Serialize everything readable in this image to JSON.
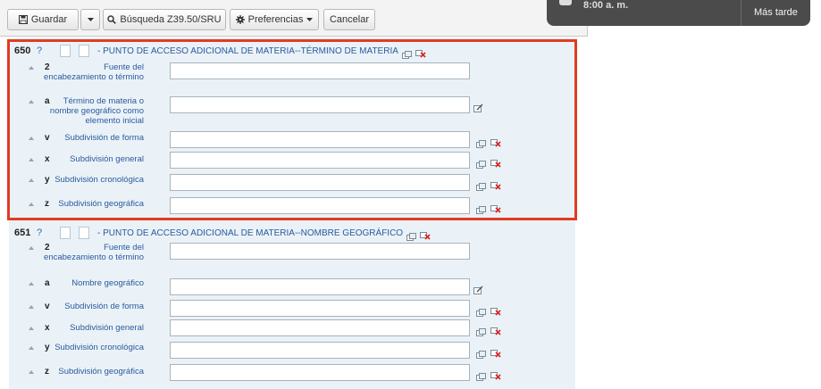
{
  "toolbar": {
    "save_label": "Guardar",
    "search_label": "Búsqueda Z39.50/SRU",
    "prefs_label": "Preferencias",
    "cancel_label": "Cancelar"
  },
  "notification": {
    "time": "8:00 a. m.",
    "later_label": "Más tarde"
  },
  "fields": [
    {
      "tag": "650",
      "help": "?",
      "title": "- PUNTO DE ACCESO ADICIONAL DE MATERIA--TÉRMINO DE MATERIA",
      "subfields": [
        {
          "code": "2",
          "label": "Fuente del encabezamiento o término"
        },
        {
          "code": "a",
          "label": "Término de materia o nombre geográfico como elemento inicial"
        },
        {
          "code": "v",
          "label": "Subdivisión de forma"
        },
        {
          "code": "x",
          "label": "Subdivisión general"
        },
        {
          "code": "y",
          "label": "Subdivisión cronológica"
        },
        {
          "code": "z",
          "label": "Subdivisión geográfica"
        }
      ]
    },
    {
      "tag": "651",
      "help": "?",
      "title": "- PUNTO DE ACCESO ADICIONAL DE MATERIA--NOMBRE GEOGRÁFICO",
      "subfields": [
        {
          "code": "2",
          "label": "Fuente del encabezamiento o término"
        },
        {
          "code": "a",
          "label": "Nombre geográfico"
        },
        {
          "code": "v",
          "label": "Subdivisión de forma"
        },
        {
          "code": "x",
          "label": "Subdivisión general"
        },
        {
          "code": "y",
          "label": "Subdivisión cronológica"
        },
        {
          "code": "z",
          "label": "Subdivisión geográfica"
        }
      ]
    }
  ]
}
